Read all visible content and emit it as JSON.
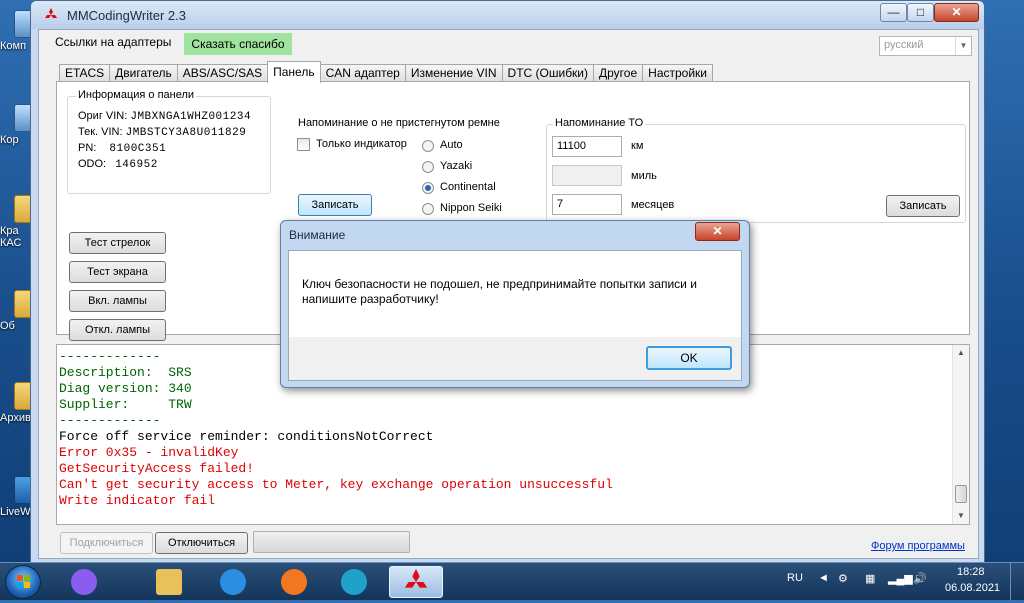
{
  "desktop": {
    "icons": [
      {
        "label": "Комп"
      },
      {
        "label": "Кор"
      },
      {
        "label": "Кра КАС"
      },
      {
        "label": "Об"
      },
      {
        "label": "Архив"
      },
      {
        "label": "LiveW"
      }
    ]
  },
  "window": {
    "title": "MMCodingWriter 2.3",
    "controls": {
      "minimize": "—",
      "maximize": "□",
      "close": "✕"
    }
  },
  "topbar": {
    "adapter_links": "Ссылки на адаптеры",
    "thanks": "Сказать спасибо",
    "language": "русский"
  },
  "tabs": [
    {
      "label": "ETACS"
    },
    {
      "label": "Двигатель"
    },
    {
      "label": "ABS/ASC/SAS"
    },
    {
      "label": "Панель",
      "active": true
    },
    {
      "label": "CAN адаптер"
    },
    {
      "label": "Изменение VIN"
    },
    {
      "label": "DTC (Ошибки)"
    },
    {
      "label": "Другое"
    },
    {
      "label": "Настройки"
    }
  ],
  "panel_info": {
    "title": "Информация о панели",
    "orig_vin_label": "Ориг VIN:",
    "orig_vin": "JMBXNGA1WHZ001234",
    "cur_vin_label": "Тек. VIN:",
    "cur_vin": "JMBSTCY3A8U011829",
    "pn_label": "PN:",
    "pn": "8100C351",
    "odo_label": "ODO:",
    "odo": "146952"
  },
  "test_buttons": {
    "needles": "Тест стрелок",
    "screen": "Тест экрана",
    "lamps_on": "Вкл. лампы",
    "lamps_off": "Откл. лампы"
  },
  "seatbelt": {
    "title": "Напоминание о не пристегнутом ремне",
    "indicator_only": "Только индикатор",
    "options": [
      "Auto",
      "Yazaki",
      "Continental",
      "Nippon Seiki"
    ],
    "selected": "Continental",
    "write": "Записать"
  },
  "service": {
    "title": "Напоминание ТО",
    "km_value": "11100",
    "km_unit": "км",
    "miles_value": "",
    "miles_unit": "миль",
    "months_value": "7",
    "months_unit": "месяцев",
    "write": "Записать"
  },
  "log": {
    "lines": [
      {
        "text": "-------------",
        "color": "#006400"
      },
      {
        "text": "Description:  SRS",
        "color": "#006400"
      },
      {
        "text": "Diag version: 340",
        "color": "#006400"
      },
      {
        "text": "Supplier:     TRW",
        "color": "#006400"
      },
      {
        "text": "-------------",
        "color": "#006400"
      },
      {
        "text": "Force off service reminder: conditionsNotCorrect",
        "color": "#000000"
      },
      {
        "text": "Error 0x35 - invalidKey",
        "color": "#e00000"
      },
      {
        "text": "GetSecurityAccess failed!",
        "color": "#e00000"
      },
      {
        "text": "Can't get security access to Meter, key exchange operation unsuccessful",
        "color": "#e00000"
      },
      {
        "text": "Write indicator fail",
        "color": "#e00000"
      }
    ]
  },
  "footer": {
    "connect": "Подключиться",
    "disconnect": "Отключиться",
    "forum": "Форум программы"
  },
  "dialog": {
    "title": "Внимание",
    "message": "Ключ безопасности не подошел, не предпринимайте попытки записи и напишите разработчику!",
    "ok": "OK"
  },
  "taskbar": {
    "apps": [
      {
        "name": "alice-icon",
        "color": "#8a5cf0"
      },
      {
        "name": "file-explorer-icon",
        "color": "#e8c15a"
      },
      {
        "name": "internet-explorer-icon",
        "color": "#2c8ee0"
      },
      {
        "name": "firefox-icon",
        "color": "#f2771f"
      },
      {
        "name": "edge-icon",
        "color": "#1fa2c9"
      },
      {
        "name": "mmcodingwriter-icon",
        "color": "#e30613"
      }
    ],
    "language": "RU",
    "time": "18:28",
    "date": "06.08.2021"
  }
}
